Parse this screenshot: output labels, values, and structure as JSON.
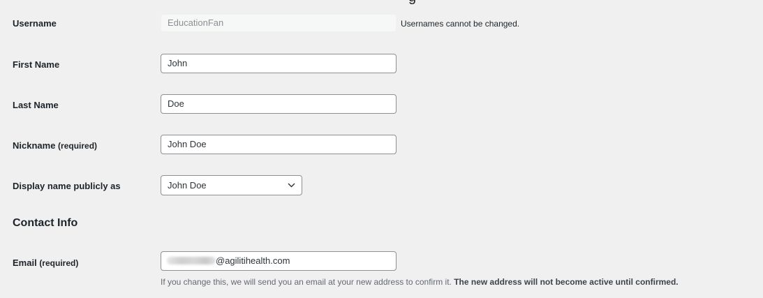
{
  "top_cropped_text": "g",
  "username": {
    "label": "Username",
    "value": "EducationFan",
    "note": "Usernames cannot be changed."
  },
  "first_name": {
    "label": "First Name",
    "value": "John"
  },
  "last_name": {
    "label": "Last Name",
    "value": "Doe"
  },
  "nickname": {
    "label": "Nickname",
    "required": "(required)",
    "value": "John Doe"
  },
  "display_name": {
    "label": "Display name publicly as",
    "selected": "John Doe",
    "icon": "chevron-down-icon"
  },
  "contact_info": {
    "heading": "Contact Info"
  },
  "email": {
    "label": "Email",
    "required": "(required)",
    "value_visible": "@agilitihealth.com",
    "description": "If you change this, we will send you an email at your new address to confirm it.",
    "description_bold": "The new address will not become active until confirmed."
  }
}
